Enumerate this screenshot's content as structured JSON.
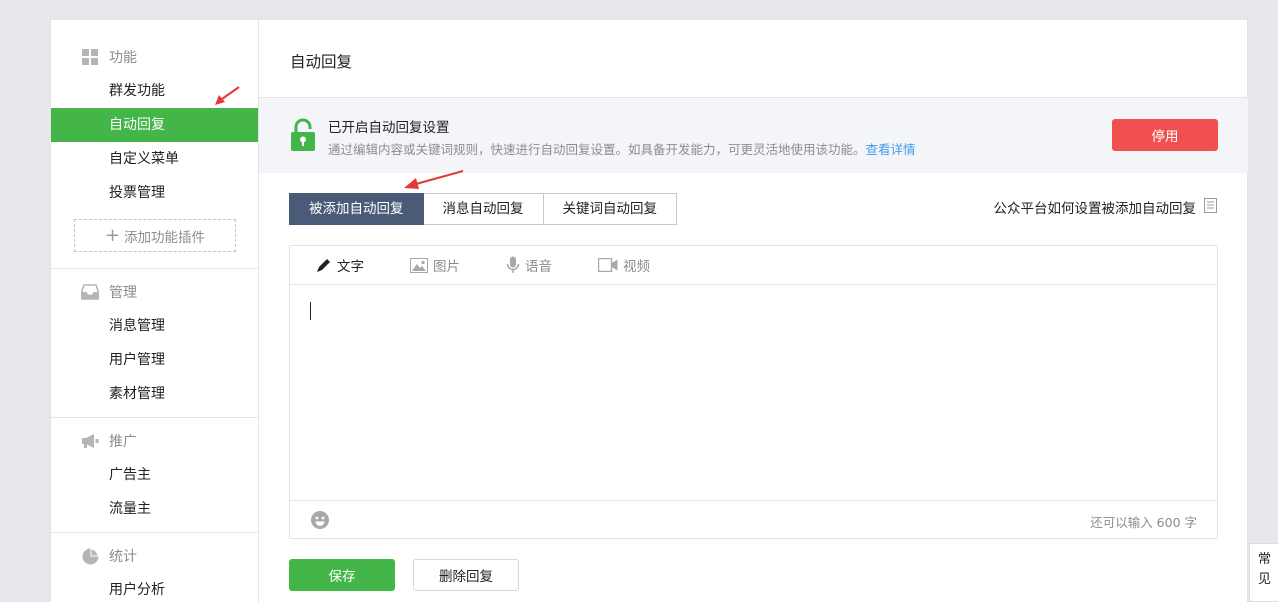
{
  "sidebar": {
    "sections": [
      {
        "title": "功能",
        "icon": "grid-icon",
        "items": [
          "群发功能",
          "自动回复",
          "自定义菜单",
          "投票管理"
        ],
        "active": 1
      },
      {
        "title": "管理",
        "icon": "inbox-icon",
        "items": [
          "消息管理",
          "用户管理",
          "素材管理"
        ]
      },
      {
        "title": "推广",
        "icon": "megaphone-icon",
        "items": [
          "广告主",
          "流量主"
        ]
      },
      {
        "title": "统计",
        "icon": "pie-chart-icon",
        "items": [
          "用户分析"
        ]
      }
    ],
    "add_plugin_label": "添加功能插件"
  },
  "main": {
    "title": "自动回复",
    "notice": {
      "title": "已开启自动回复设置",
      "description": "通过编辑内容或关键词规则，快速进行自动回复设置。如具备开发能力，可更灵活地使用该功能。",
      "link": "查看详情",
      "disable_label": "停用"
    },
    "tabs": [
      "被添加自动回复",
      "消息自动回复",
      "关键词自动回复"
    ],
    "active_tab": 0,
    "help_link": "公众平台如何设置被添加自动回复",
    "editor": {
      "tools": [
        {
          "label": "文字",
          "icon": "pencil-icon"
        },
        {
          "label": "图片",
          "icon": "image-icon"
        },
        {
          "label": "语音",
          "icon": "microphone-icon"
        },
        {
          "label": "视频",
          "icon": "video-icon"
        }
      ],
      "active_tool": 0,
      "value": "",
      "counter": "还可以输入 600 字"
    },
    "save_label": "保存",
    "delete_label": "删除回复"
  },
  "faq_tab": {
    "line1": "常",
    "line2": "见"
  },
  "colors": {
    "green": "#44b549",
    "red": "#f05050",
    "tab_active": "#4a5b78",
    "link": "#459ae9"
  }
}
